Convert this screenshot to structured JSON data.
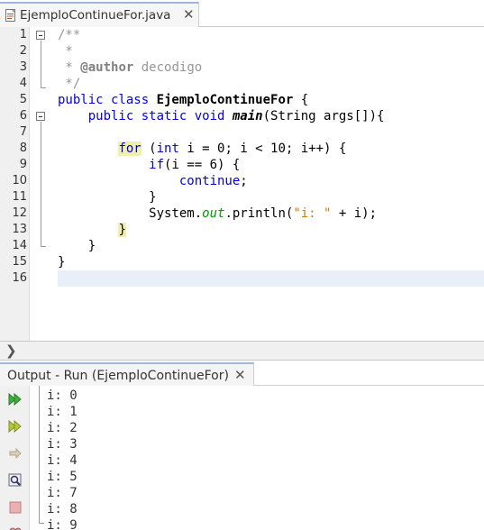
{
  "editor_tab": {
    "title": "EjemploContinueFor.java",
    "close_glyph": "✕",
    "icon": "java-file-icon"
  },
  "editor": {
    "line_numbers": [
      "1",
      "2",
      "3",
      "4",
      "5",
      "6",
      "7",
      "8",
      "9",
      "10",
      "11",
      "12",
      "13",
      "14",
      "15",
      "16"
    ],
    "lines": [
      [
        {
          "t": "/**",
          "c": "cm"
        }
      ],
      [
        {
          "t": " *",
          "c": "cm"
        }
      ],
      [
        {
          "t": " * ",
          "c": "cm"
        },
        {
          "t": "@author",
          "c": "tag"
        },
        {
          "t": " decodigo",
          "c": "cm"
        }
      ],
      [
        {
          "t": " */",
          "c": "cm"
        }
      ],
      [
        {
          "t": "public class ",
          "c": "k"
        },
        {
          "t": "EjemploContinueFor",
          "c": "cls"
        },
        {
          "t": " {",
          "c": ""
        }
      ],
      [
        {
          "t": "    ",
          "c": ""
        },
        {
          "t": "public static void ",
          "c": "k"
        },
        {
          "t": "main",
          "c": "fn"
        },
        {
          "t": "(String args[]){",
          "c": ""
        }
      ],
      [
        {
          "t": "",
          "c": ""
        }
      ],
      [
        {
          "t": "        ",
          "c": ""
        },
        {
          "t": "for",
          "c": "k hl"
        },
        {
          "t": " (",
          "c": ""
        },
        {
          "t": "int",
          "c": "k"
        },
        {
          "t": " i = 0; i < 10; i++) {",
          "c": ""
        }
      ],
      [
        {
          "t": "            ",
          "c": ""
        },
        {
          "t": "if",
          "c": "k"
        },
        {
          "t": "(i == 6) {",
          "c": ""
        }
      ],
      [
        {
          "t": "                ",
          "c": ""
        },
        {
          "t": "continue",
          "c": "k"
        },
        {
          "t": ";",
          "c": ""
        }
      ],
      [
        {
          "t": "            }",
          "c": ""
        }
      ],
      [
        {
          "t": "            System.",
          "c": ""
        },
        {
          "t": "out",
          "c": "st"
        },
        {
          "t": ".println(",
          "c": ""
        },
        {
          "t": "\"i: \"",
          "c": "str"
        },
        {
          "t": " + i);",
          "c": ""
        }
      ],
      [
        {
          "t": "        ",
          "c": ""
        },
        {
          "t": "}",
          "c": "hl"
        }
      ],
      [
        {
          "t": "    }",
          "c": ""
        }
      ],
      [
        {
          "t": "}",
          "c": ""
        }
      ],
      [
        {
          "t": "",
          "c": ""
        }
      ]
    ]
  },
  "navbar": {
    "chevron": "❯"
  },
  "output": {
    "title": "Output - Run (EjemploContinueFor)",
    "close_glyph": "✕",
    "lines": [
      "i: 0",
      "i: 1",
      "i: 2",
      "i: 3",
      "i: 4",
      "i: 5",
      "i: 7",
      "i: 8",
      "i: 9"
    ],
    "toolbar_icons": [
      "rerun-icon",
      "rerun-with-options-icon",
      "step-icon",
      "find-icon",
      "stop-icon"
    ]
  }
}
